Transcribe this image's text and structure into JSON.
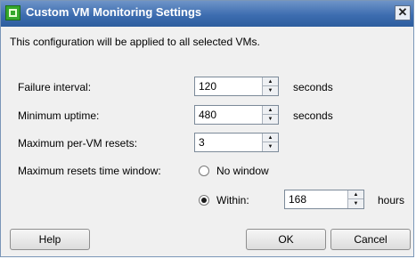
{
  "window": {
    "title": "Custom VM Monitoring Settings",
    "close_glyph": "✕"
  },
  "info_text": "This configuration will be applied to all selected VMs.",
  "fields": {
    "failure_interval": {
      "label": "Failure interval:",
      "value": "120",
      "unit": "seconds"
    },
    "minimum_uptime": {
      "label": "Minimum uptime:",
      "value": "480",
      "unit": "seconds"
    },
    "max_resets": {
      "label": "Maximum per-VM resets:",
      "value": "3"
    },
    "reset_window": {
      "label": "Maximum resets time window:",
      "option_no_window": "No window",
      "option_within": "Within:",
      "selected": "within",
      "within_value": "168",
      "unit": "hours"
    }
  },
  "buttons": {
    "help": "Help",
    "ok": "OK",
    "cancel": "Cancel"
  },
  "icons": {
    "app": "vm-monitoring-icon",
    "close": "close-icon",
    "spin_up": "spin-up-icon",
    "spin_down": "spin-down-icon"
  },
  "colors": {
    "titlebar": "#3d6db0",
    "dialog_bg": "#f0f0f0"
  }
}
